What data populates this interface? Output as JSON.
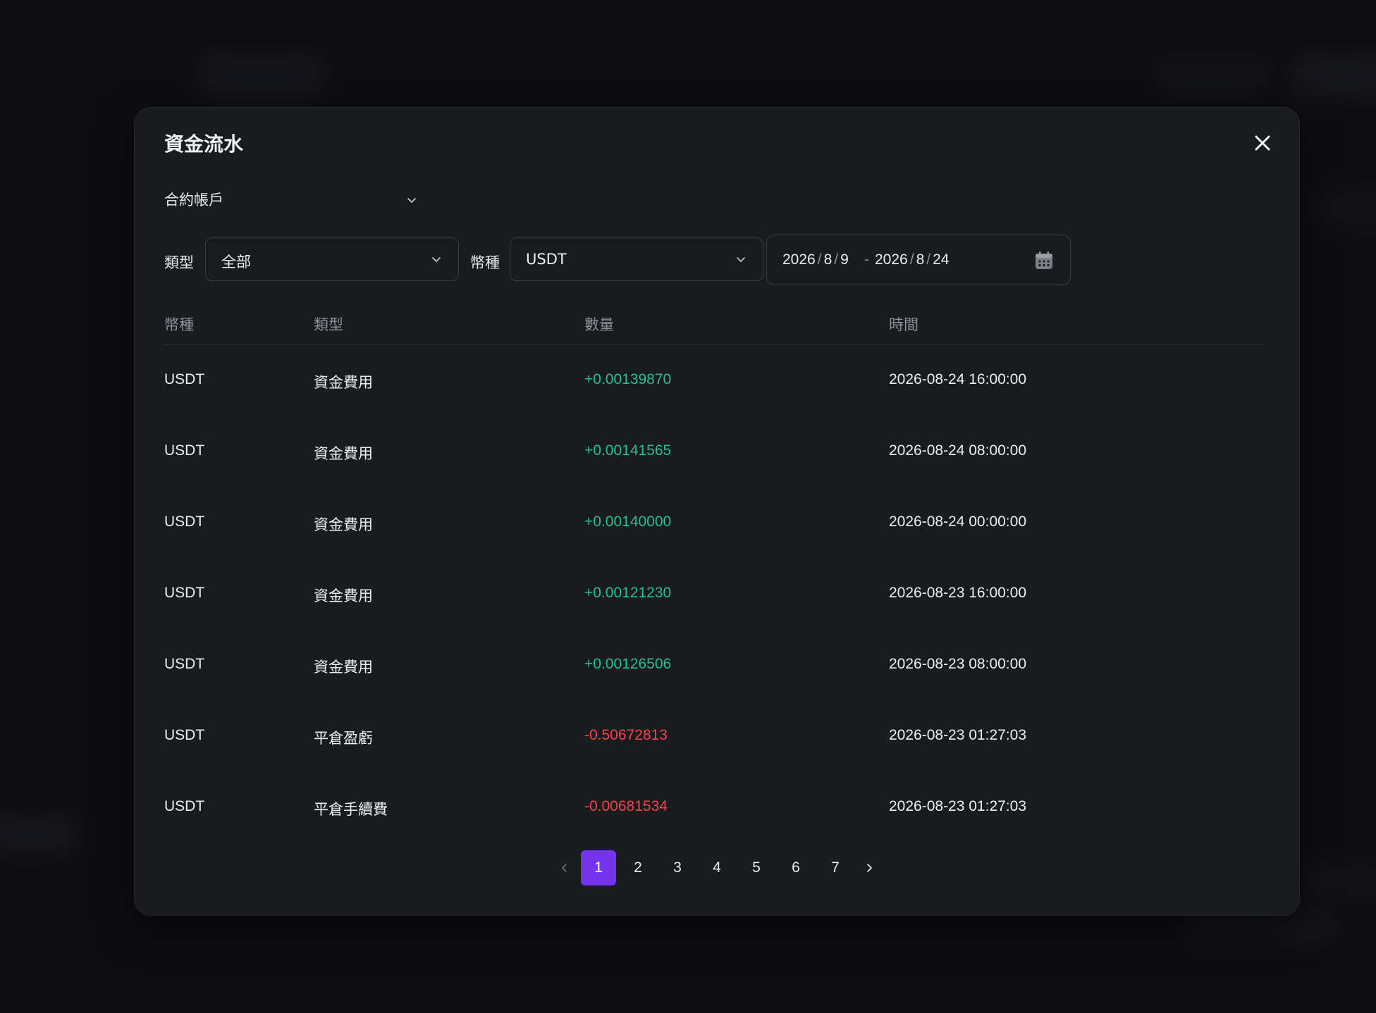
{
  "modal": {
    "title": "資金流水",
    "account": "合約帳戶"
  },
  "filters": {
    "type_label": "類型",
    "type_value": "全部",
    "coin_label": "幣種",
    "coin_value": "USDT",
    "date_start": {
      "year": "2026",
      "month": "8",
      "day": "9"
    },
    "date_end": {
      "year": "2026",
      "month": "8",
      "day": "24"
    },
    "date_separator": "-",
    "date_part_separator": "/"
  },
  "table": {
    "headers": [
      "幣種",
      "類型",
      "數量",
      "時間"
    ],
    "rows": [
      {
        "coin": "USDT",
        "type": "資金費用",
        "amount": "+0.00139870",
        "time": "2026-08-24 16:00:00",
        "sign": "pos"
      },
      {
        "coin": "USDT",
        "type": "資金費用",
        "amount": "+0.00141565",
        "time": "2026-08-24 08:00:00",
        "sign": "pos"
      },
      {
        "coin": "USDT",
        "type": "資金費用",
        "amount": "+0.00140000",
        "time": "2026-08-24 00:00:00",
        "sign": "pos"
      },
      {
        "coin": "USDT",
        "type": "資金費用",
        "amount": "+0.00121230",
        "time": "2026-08-23 16:00:00",
        "sign": "pos"
      },
      {
        "coin": "USDT",
        "type": "資金費用",
        "amount": "+0.00126506",
        "time": "2026-08-23 08:00:00",
        "sign": "pos"
      },
      {
        "coin": "USDT",
        "type": "平倉盈虧",
        "amount": "-0.50672813",
        "time": "2026-08-23 01:27:03",
        "sign": "neg"
      },
      {
        "coin": "USDT",
        "type": "平倉手續費",
        "amount": "-0.00681534",
        "time": "2026-08-23 01:27:03",
        "sign": "neg"
      }
    ]
  },
  "pagination": {
    "pages": [
      "1",
      "2",
      "3",
      "4",
      "5",
      "6",
      "7"
    ],
    "current": "1"
  },
  "colors": {
    "accent": "#7434f0",
    "positive": "#27c08f",
    "negative": "#f0454e",
    "modal_bg": "#1a1b1f"
  },
  "icons": {
    "close": "close-icon",
    "dropdown": "chevron-down-icon",
    "calendar": "calendar-icon",
    "prev": "chevron-left-icon",
    "next": "chevron-right-icon"
  }
}
